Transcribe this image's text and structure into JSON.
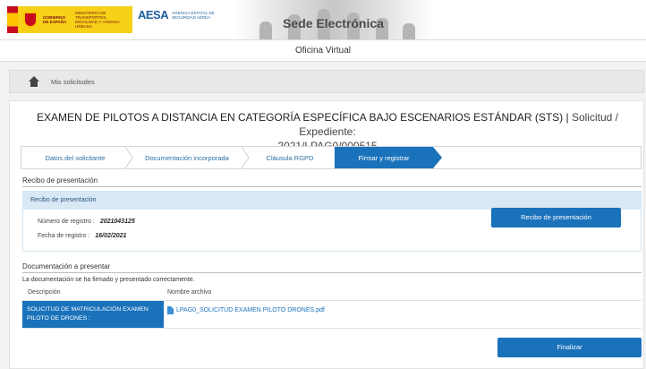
{
  "header": {
    "gov_left": "GOBIERNO DE ESPAÑA",
    "gov_right": "MINISTERIO DE TRANSPORTES, MOVILIDAD Y AGENDA URBANA",
    "aesa_mark": "AESA",
    "aesa_sub": "AGENCIA ESTATAL DE SEGURIDAD AÉREA",
    "portal_title": "Sede Electrónica"
  },
  "office": {
    "title": "Oficina Virtual"
  },
  "breadcrumb": {
    "item": "Mis solicitudes"
  },
  "page": {
    "title_main": "EXAMEN DE PILOTOS A DISTANCIA EN CATEGORÍA ESPECÍFICA BAJO ESCENARIOS ESTÁNDAR (STS)",
    "title_sep": " | ",
    "title_req": "Solicitud / Expediente:",
    "expediente": "2021/LPAG0/000515"
  },
  "steps": [
    {
      "label": "Datos del solicitante"
    },
    {
      "label": "Documentación incorporada"
    },
    {
      "label": "Cláusula RGPD"
    },
    {
      "label": "Firmar y registrar"
    }
  ],
  "receipt": {
    "section_title": "Recibo de presentación",
    "box_header": "Recibo de presentación",
    "reg_number_label": "Número de registro :",
    "reg_number_value": "2021043125",
    "reg_date_label": "Fecha de registro :",
    "reg_date_value": "16/02/2021",
    "button_label": "Recibo de presentación"
  },
  "documents": {
    "section_title": "Documentación a presentar",
    "message": "La documentación se ha firmado y presentado correctamente.",
    "col_description": "Descripción",
    "col_filename": "Nombre archivo",
    "rows": [
      {
        "description": "SOLICITUD DE MATRICULACIÓN EXAMEN PILOTO DE DRONES :",
        "filename": "LPAG0_SOLICITUD EXAMEN PILOTO DRONES.pdf"
      }
    ]
  },
  "actions": {
    "finish_label": "Finalizar"
  },
  "colors": {
    "accent": "#1a72bb",
    "light_accent": "#d9e8f5"
  }
}
